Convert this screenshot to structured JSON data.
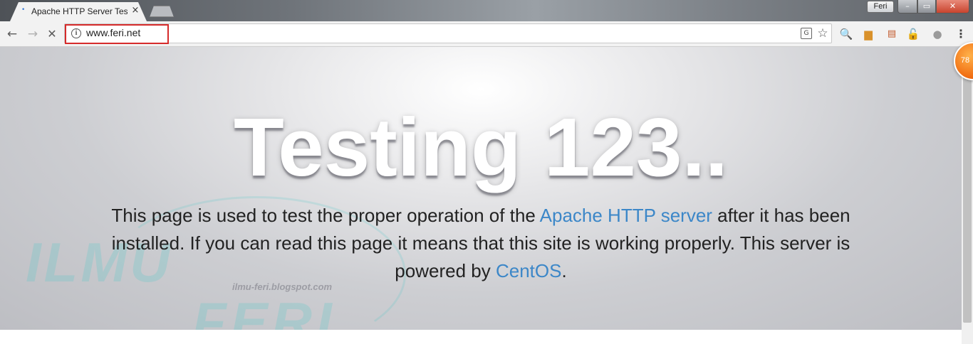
{
  "browser": {
    "tab": {
      "title": "Apache HTTP Server Test",
      "close": "×"
    },
    "profile": "Feri",
    "window_controls": {
      "minimize": "–",
      "maximize": "▭",
      "close": "✕"
    },
    "nav": {
      "back": "←",
      "forward": "→",
      "stop": "✕"
    },
    "address": {
      "url": "www.feri.net",
      "info_glyph": "i"
    },
    "icons": {
      "translate": "G",
      "bookmark": "☆",
      "ext_search": "🔍",
      "ext_folder": "▆",
      "ext_news": "▤",
      "ext_lock": "🔓",
      "ext_gray": "●",
      "menu": "⋮"
    },
    "accent": "#3c87c8",
    "highlight_color": "#d62b2b"
  },
  "page": {
    "title": "Testing 123..",
    "lead_part1": "This page is used to test the proper operation of the ",
    "apache_link": "Apache HTTP server",
    "lead_part2": " after it has been installed. If you can read this page it means that this site is working properly. This server is powered by ",
    "centos_link": "CentOS",
    "lead_part3": "."
  },
  "watermark": {
    "line1": "ILMU",
    "line2": "FERI",
    "url": "ilmu-feri.blogspot.com"
  },
  "badge": {
    "count": "78"
  }
}
